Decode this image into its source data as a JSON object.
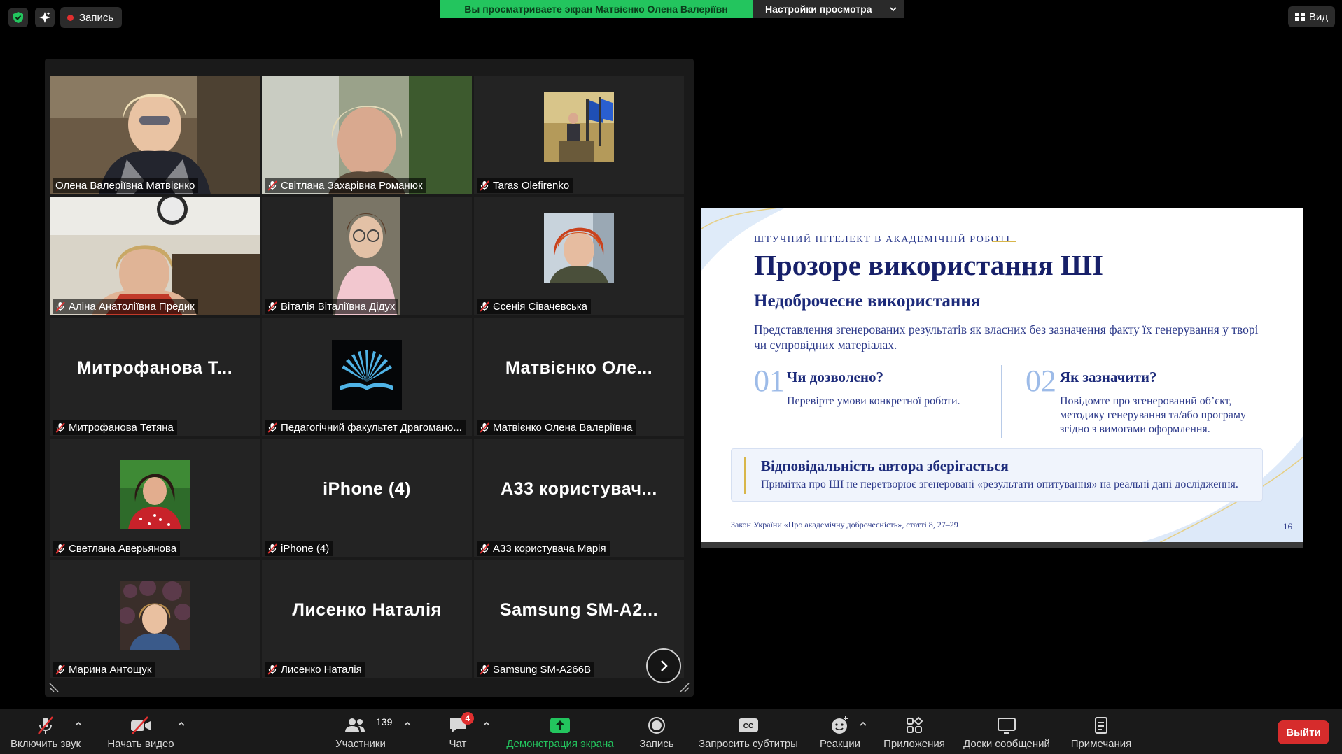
{
  "topbar": {
    "record_label": "Запись",
    "share_notice": "Вы просматриваете экран Матвієнко Олена Валеріївн",
    "view_settings": "Настройки просмотра",
    "view_label": "Вид"
  },
  "gallery": {
    "tiles": [
      {
        "name": "Олена Валеріївна Матвієнко",
        "type": "video",
        "muted": false,
        "active": true
      },
      {
        "name": "Світлана Захарівна Романюк",
        "type": "video",
        "muted": true
      },
      {
        "name": "Taras Olefirenko",
        "type": "photo",
        "muted": true
      },
      {
        "name": "Аліна Анатоліївна Предик",
        "type": "video",
        "muted": true
      },
      {
        "name": "Віталія Віталіївна Дідух",
        "type": "video",
        "muted": true
      },
      {
        "name": "Єсенія Сівачевська",
        "type": "photo",
        "muted": true
      },
      {
        "name": "Митрофанова Тетяна",
        "type": "name",
        "big": "Митрофанова Т...",
        "muted": true
      },
      {
        "name": "Педагогічний факультет Драгомано...",
        "type": "logo",
        "muted": true
      },
      {
        "name": "Матвієнко Олена Валеріївна",
        "type": "name",
        "big": "Матвієнко Оле...",
        "muted": true
      },
      {
        "name": "Светлана Аверьянова",
        "type": "photo",
        "muted": true
      },
      {
        "name": "iPhone (4)",
        "type": "name",
        "big": "iPhone (4)",
        "muted": true
      },
      {
        "name": "A33 користувача Марія",
        "type": "name",
        "big": "A33  користувач...",
        "muted": true
      },
      {
        "name": "Марина Антощук",
        "type": "photo",
        "muted": true
      },
      {
        "name": "Лисенко Наталія",
        "type": "name",
        "big": "Лисенко Наталія",
        "muted": true
      },
      {
        "name": "Samsung SM-A266B",
        "type": "name",
        "big": "Samsung  SM-A2...",
        "muted": true
      }
    ]
  },
  "slide": {
    "kicker": "ШТУЧНИЙ ІНТЕЛЕКТ В АКАДЕМІЧНІЙ РОБОТІ",
    "title": "Прозоре використання ШІ",
    "subtitle": "Недоброчесне використання",
    "body": "Представлення згенерованих результатів як власних без зазначення факту їх генерування у творі чи супровідних матеріалах.",
    "col1": {
      "num": "01",
      "heading": "Чи дозволено?",
      "text": "Перевірте умови конкретної роботи."
    },
    "col2": {
      "num": "02",
      "heading": "Як зазначити?",
      "text": "Повідомте про згенерований об’єкт, методику генерування та/або програму згідно з вимогами оформлення."
    },
    "box": {
      "heading": "Відповідальність автора зберігається",
      "text": "Примітка про ШІ не перетворює згенеровані «результати опитування» на реальні дані дослідження."
    },
    "footer": "Закон України «Про академічну доброчесність», статті 8, 27–29",
    "page": "16"
  },
  "toolbar": {
    "audio": "Включить звук",
    "video": "Начать видео",
    "participants": "Участники",
    "participants_count": "139",
    "chat": "Чат",
    "chat_badge": "4",
    "share": "Демонстрация экрана",
    "record": "Запись",
    "captions": "Запросить субтитры",
    "reactions": "Реакции",
    "apps": "Приложения",
    "whiteboards": "Доски сообщений",
    "notes": "Примечания",
    "leave": "Выйти"
  },
  "colors": {
    "accent_green": "#23c55e",
    "leave_red": "#d62c2c",
    "active_speaker": "#d9e26a"
  }
}
